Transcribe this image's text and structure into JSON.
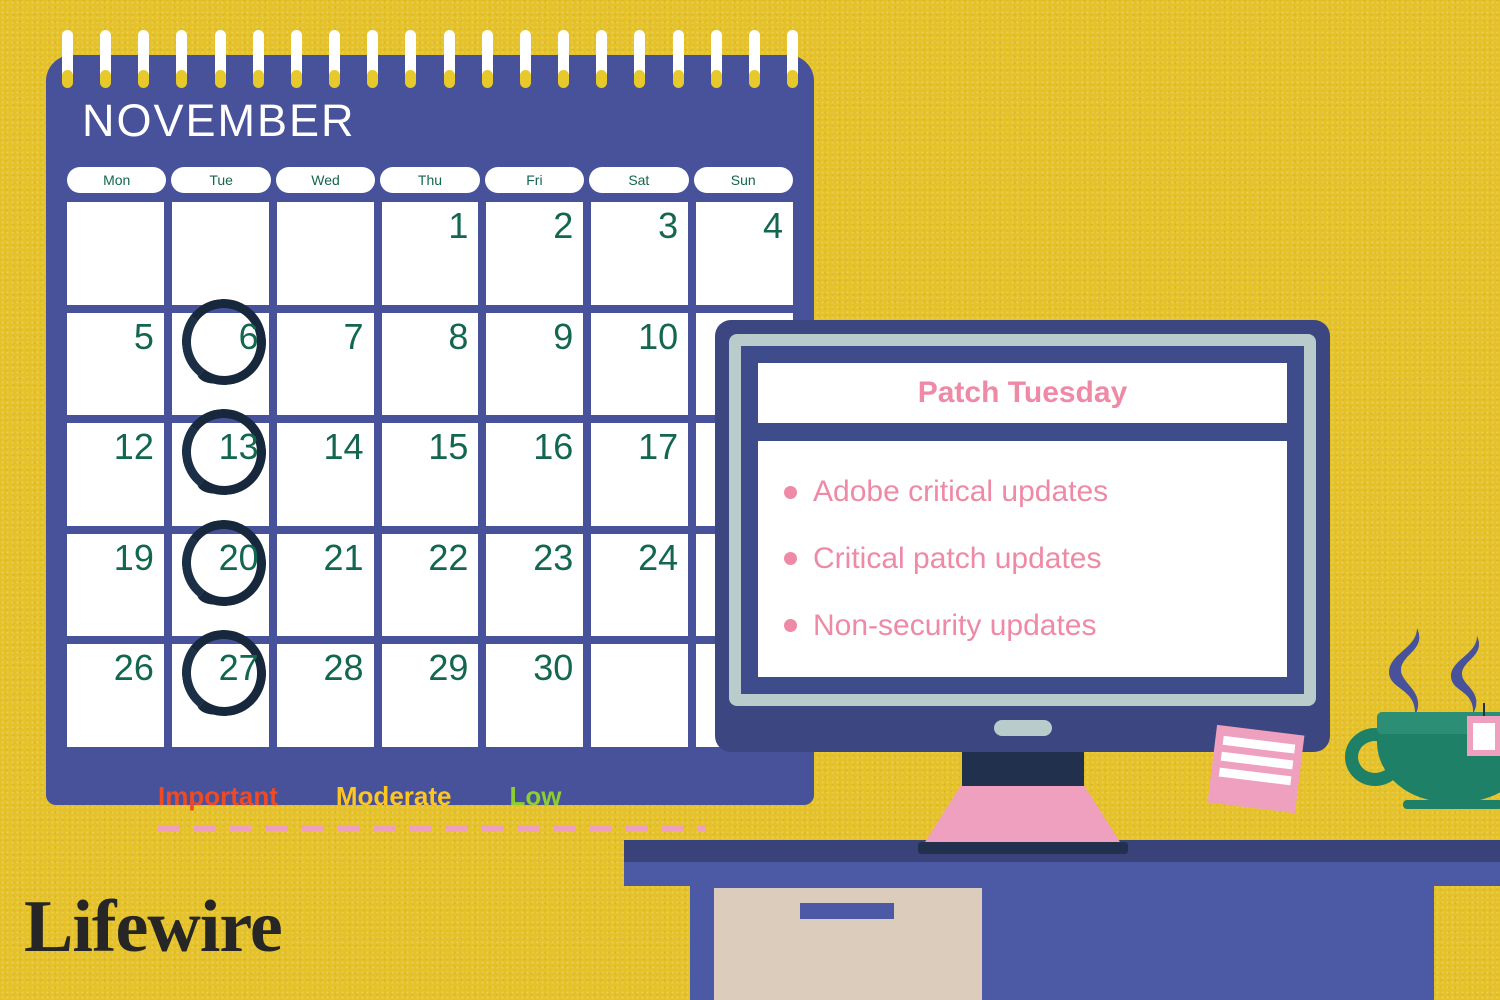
{
  "theme": {
    "background": "#E5C229",
    "calendar_panel": "#47529B",
    "calendar_text": "#FFFFFF",
    "day_number": "#13664F",
    "weekday_label": "#13664F",
    "circle_mark": "#17283D",
    "monitor_bezel": "#3C4782",
    "monitor_band": "#B9CBCB",
    "monitor_screen_frame": "#3F4C8C",
    "screen_text": "#EE89A6",
    "pink_accent": "#EFA0BE",
    "desk_blue": "#4C59A5",
    "desk_edge": "#39437A",
    "drawer_beige": "#DCCCBC",
    "cup_green": "#1F8068",
    "steam_blue": "#47529B",
    "logo_dark": "#262626"
  },
  "calendar": {
    "month_title": "NOVEMBER",
    "spiral_ring_count": 20,
    "weekdays": [
      "Mon",
      "Tue",
      "Wed",
      "Thu",
      "Fri",
      "Sat",
      "Sun"
    ],
    "weeks": [
      [
        {
          "day": "",
          "circled": false
        },
        {
          "day": "",
          "circled": false
        },
        {
          "day": "",
          "circled": false
        },
        {
          "day": "1",
          "circled": false
        },
        {
          "day": "2",
          "circled": false
        },
        {
          "day": "3",
          "circled": false
        },
        {
          "day": "4",
          "circled": false
        }
      ],
      [
        {
          "day": "5",
          "circled": false
        },
        {
          "day": "6",
          "circled": true
        },
        {
          "day": "7",
          "circled": false
        },
        {
          "day": "8",
          "circled": false
        },
        {
          "day": "9",
          "circled": false
        },
        {
          "day": "10",
          "circled": false
        },
        {
          "day": "",
          "circled": false
        }
      ],
      [
        {
          "day": "12",
          "circled": false
        },
        {
          "day": "13",
          "circled": true
        },
        {
          "day": "14",
          "circled": false
        },
        {
          "day": "15",
          "circled": false
        },
        {
          "day": "16",
          "circled": false
        },
        {
          "day": "17",
          "circled": false
        },
        {
          "day": "",
          "circled": false
        }
      ],
      [
        {
          "day": "19",
          "circled": false
        },
        {
          "day": "20",
          "circled": true
        },
        {
          "day": "21",
          "circled": false
        },
        {
          "day": "22",
          "circled": false
        },
        {
          "day": "23",
          "circled": false
        },
        {
          "day": "24",
          "circled": false
        },
        {
          "day": "",
          "circled": false
        }
      ],
      [
        {
          "day": "26",
          "circled": false
        },
        {
          "day": "27",
          "circled": true
        },
        {
          "day": "28",
          "circled": false
        },
        {
          "day": "29",
          "circled": false
        },
        {
          "day": "30",
          "circled": false
        },
        {
          "day": "",
          "circled": false
        },
        {
          "day": "",
          "circled": false
        }
      ]
    ],
    "legend": [
      {
        "label": "Important",
        "color": "#F04A23"
      },
      {
        "label": "Moderate",
        "color": "#FFC61E"
      },
      {
        "label": "Low",
        "color": "#8CD02F"
      }
    ]
  },
  "monitor": {
    "screen_title": "Patch Tuesday",
    "bullets": [
      "Adobe critical updates",
      "Critical patch updates",
      "Non-security updates"
    ],
    "power_button": "power-button"
  },
  "sticky_note": {
    "line_count": 3
  },
  "desk": {
    "drawer_handle": "drawer-handle"
  },
  "cup": {
    "steam_wisps": 2,
    "tea_tag": "tea-bag-tag"
  },
  "branding": {
    "logo_text": "Lifewire"
  }
}
